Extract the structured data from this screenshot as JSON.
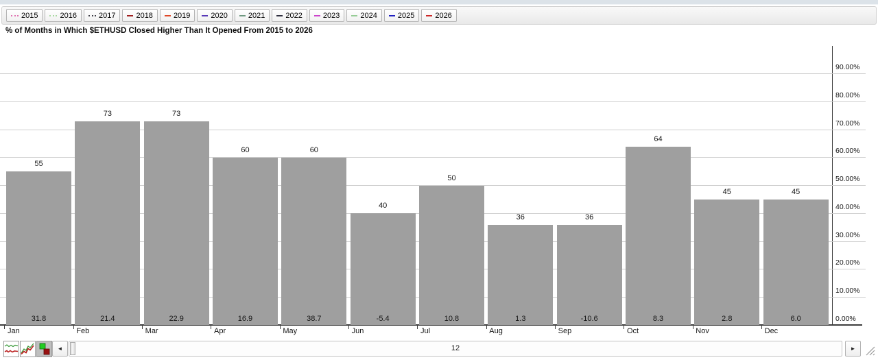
{
  "title": "% of Months in Which $ETHUSD Closed Higher Than It Opened From 2015 to 2026",
  "toolbar": {
    "years": [
      {
        "label": "2015",
        "line_style": "dotted",
        "color": "#e070b0"
      },
      {
        "label": "2016",
        "line_style": "dotted",
        "color": "#a8d8a0"
      },
      {
        "label": "2017",
        "line_style": "dotted",
        "color": "#404048"
      },
      {
        "label": "2018",
        "line_style": "solid",
        "color": "#a02020"
      },
      {
        "label": "2019",
        "line_style": "solid",
        "color": "#e04828"
      },
      {
        "label": "2020",
        "line_style": "solid",
        "color": "#5838b8"
      },
      {
        "label": "2021",
        "line_style": "solid",
        "color": "#6e9880"
      },
      {
        "label": "2022",
        "line_style": "solid",
        "color": "#303040"
      },
      {
        "label": "2023",
        "line_style": "solid",
        "color": "#cc44cc"
      },
      {
        "label": "2024",
        "line_style": "solid",
        "color": "#96cc96"
      },
      {
        "label": "2025",
        "line_style": "solid",
        "color": "#2020c0"
      },
      {
        "label": "2026",
        "line_style": "solid",
        "color": "#cc2828"
      }
    ]
  },
  "chart_data": {
    "type": "bar",
    "title": "% of Months in Which $ETHUSD Closed Higher Than It Opened From 2015 to 2026",
    "categories": [
      "Jan",
      "Feb",
      "Mar",
      "Apr",
      "May",
      "Jun",
      "Jul",
      "Aug",
      "Sep",
      "Oct",
      "Nov",
      "Dec"
    ],
    "series": [
      {
        "name": "pct_months_closed_higher",
        "values": [
          55,
          73,
          73,
          60,
          60,
          40,
          50,
          36,
          36,
          64,
          45,
          45
        ]
      },
      {
        "name": "avg_monthly_change_label",
        "values": [
          "31.8",
          "21.4",
          "22.9",
          "16.9",
          "38.7",
          "-5.4",
          "10.8",
          "1.3",
          "-10.6",
          "8.3",
          "2.8",
          "6.0"
        ]
      }
    ],
    "y_axis": {
      "position": "right",
      "ticks": [
        "0.00%",
        "10.00%",
        "20.00%",
        "30.00%",
        "40.00%",
        "50.00%",
        "60.00%",
        "70.00%",
        "80.00%",
        "90.00%"
      ],
      "min": 0,
      "max": 100
    },
    "bar_color": "#9f9f9f",
    "grid": true,
    "legend_position": "none"
  },
  "bottom_bar": {
    "scroll_value": "12",
    "left_arrow": "◄",
    "right_arrow": "►",
    "chart_type_buttons": [
      "seasonal-lines-chart-icon",
      "cumulative-lines-chart-icon",
      "bar-chart-mode-icon"
    ]
  }
}
